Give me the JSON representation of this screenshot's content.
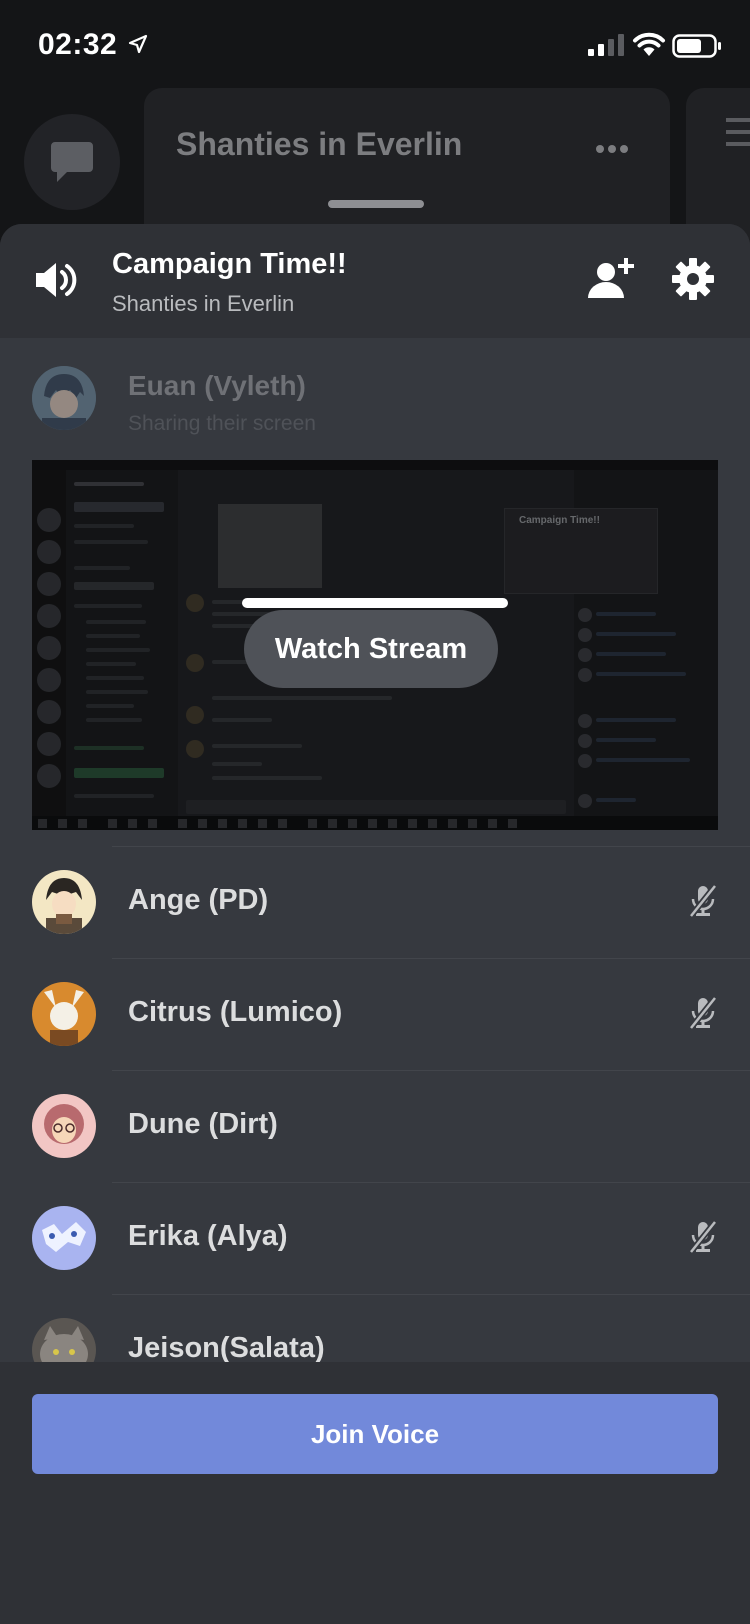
{
  "status_bar": {
    "time": "02:32"
  },
  "background": {
    "channel_panel_title": "Shanties in Everlin"
  },
  "sheet": {
    "header": {
      "channel_name": "Campaign Time!!",
      "server_name": "Shanties in Everlin"
    },
    "streamer": {
      "name": "Euan (Vyleth)",
      "status": "Sharing their screen"
    },
    "stream": {
      "watch_label": "Watch Stream",
      "preview_mini_title": "Campaign Time!!"
    },
    "members": [
      {
        "name": "Ange (PD)",
        "muted": true
      },
      {
        "name": "Citrus (Lumico)",
        "muted": true
      },
      {
        "name": "Dune (Dirt)",
        "muted": false
      },
      {
        "name": "Erika (Alya)",
        "muted": true
      },
      {
        "name": "Jeison(Salata)",
        "muted": false
      }
    ],
    "footer": {
      "join_voice_label": "Join Voice"
    }
  },
  "colors": {
    "accent": "#7289da",
    "sheet_bg": "#36393f",
    "header_bg": "#2f3136",
    "app_bg": "#141517"
  }
}
